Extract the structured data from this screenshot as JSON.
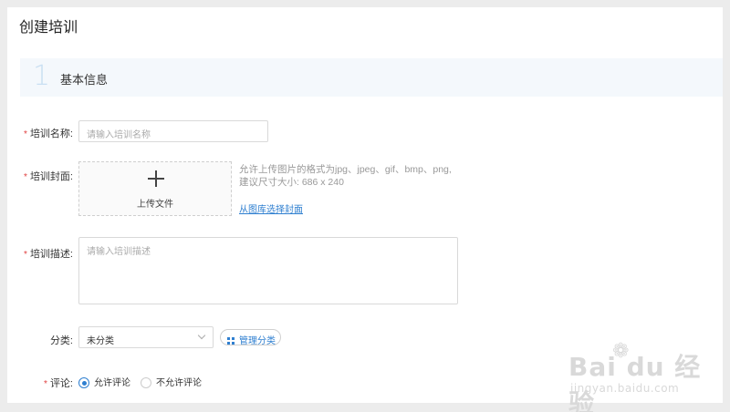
{
  "page": {
    "title": "创建培训"
  },
  "section": {
    "number": "1",
    "title": "基本信息"
  },
  "form": {
    "name": {
      "label": "培训名称:",
      "required": "*",
      "placeholder": "请输入培训名称"
    },
    "cover": {
      "label": "培训封面:",
      "required": "*",
      "upload_label": "上传文件",
      "hint_line1": "允许上传图片的格式为jpg、jpeg、gif、bmp、png,",
      "hint_line2": "建议尺寸大小: 686 x 240",
      "library_link": "从图库选择封面"
    },
    "description": {
      "label": "培训描述:",
      "required": "*",
      "placeholder": "请输入培训描述"
    },
    "category": {
      "label": "分类:",
      "selected": "未分类",
      "manage_label": "管理分类"
    },
    "comment": {
      "label": "评论:",
      "required": "*",
      "options": [
        {
          "label": "允许评论",
          "checked": true
        },
        {
          "label": "不允许评论",
          "checked": false
        }
      ]
    }
  },
  "watermark": {
    "main": "Bai du 经验",
    "sub": "jingyan.baidu.com"
  },
  "colors": {
    "accent": "#2f7fd0",
    "required": "#e04040",
    "section_bg": "#f4f8fc"
  }
}
